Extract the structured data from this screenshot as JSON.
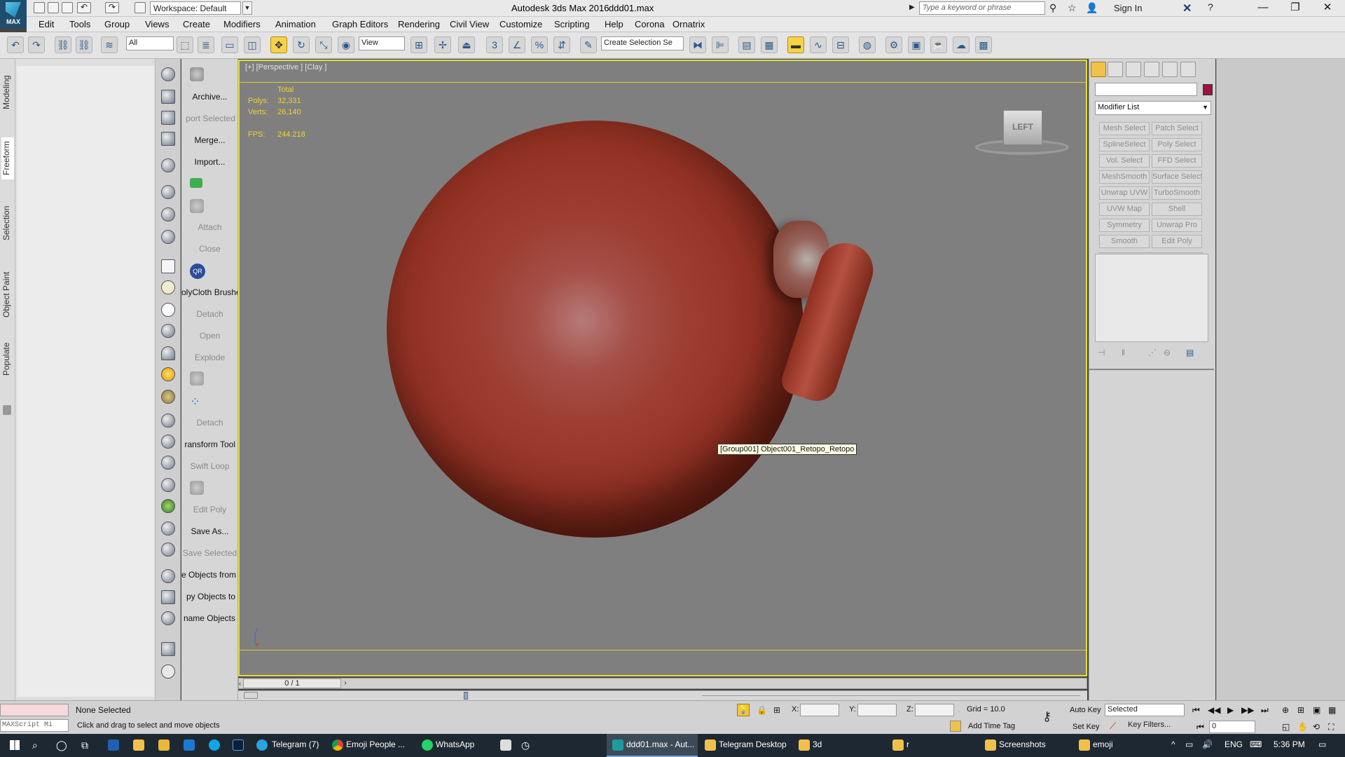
{
  "titlebar": {
    "logo_label": "MAX",
    "workspace": "Workspace: Default",
    "app_title": "Autodesk 3ds Max 2016",
    "doc_name": "ddd01.max",
    "search_placeholder": "Type a keyword or phrase",
    "sign_in": "Sign In"
  },
  "menu": [
    "Edit",
    "Tools",
    "Group",
    "Views",
    "Create",
    "Modifiers",
    "Animation",
    "Graph Editors",
    "Rendering",
    "Civil View",
    "Customize",
    "Scripting",
    "Help",
    "Corona",
    "Ornatrix"
  ],
  "toolbar": {
    "filter": "All",
    "ref_coord": "View",
    "selection_set_placeholder": "Create Selection Se"
  },
  "ribbon_tabs": [
    "Modeling",
    "Freeform",
    "Selection",
    "Object Paint",
    "Populate"
  ],
  "tool_labels": [
    {
      "text": "Archive...",
      "dim": false
    },
    {
      "text": "port Selected",
      "dim": true
    },
    {
      "text": "Merge...",
      "dim": false
    },
    {
      "text": "Import...",
      "dim": false
    },
    {
      "text": "Attach",
      "dim": true
    },
    {
      "text": "Close",
      "dim": true
    },
    {
      "text": "olyCloth Brushe",
      "dim": false
    },
    {
      "text": "Detach",
      "dim": true
    },
    {
      "text": "Open",
      "dim": true
    },
    {
      "text": "Explode",
      "dim": true
    },
    {
      "text": "Detach",
      "dim": true
    },
    {
      "text": "ransform Tool",
      "dim": false
    },
    {
      "text": "Swift Loop",
      "dim": true
    },
    {
      "text": "Edit Poly",
      "dim": true
    },
    {
      "text": "Save As...",
      "dim": false
    },
    {
      "text": "Save Selected",
      "dim": true
    },
    {
      "text": "e Objects from",
      "dim": false
    },
    {
      "text": "py Objects to",
      "dim": false
    },
    {
      "text": "name Objects",
      "dim": false
    }
  ],
  "viewport": {
    "label": "[+] [Perspective ] [Clay ]",
    "stats_header": "Total",
    "polys_label": "Polys:",
    "polys_value": "32,331",
    "verts_label": "Verts:",
    "verts_value": "26,140",
    "fps_label": "FPS:",
    "fps_value": "244.218",
    "viewcube": "LEFT",
    "tooltip": "[Group001] Object001_Retopo_Retopo",
    "axis_z": "z",
    "axis_x": "x"
  },
  "timeslider": {
    "frame": "0 / 1"
  },
  "command_panel": {
    "modifier_list": "Modifier List",
    "buttons": [
      "Mesh Select",
      "Patch Select",
      "SplineSelect",
      "Poly Select",
      "Vol. Select",
      "FFD Select",
      "MeshSmooth",
      "Surface Select",
      "Unwrap UVW",
      "TurboSmooth",
      "UVW Map",
      "Shell",
      "Symmetry",
      "Unwrap Pro",
      "Smooth",
      "Edit Poly"
    ],
    "swatch_color": "#a0123e"
  },
  "status": {
    "maxscript": "MAXScript Mi",
    "selection": "None Selected",
    "hint": "Click and drag to select and move objects",
    "x_label": "X:",
    "y_label": "Y:",
    "z_label": "Z:",
    "grid": "Grid = 10.0",
    "add_time_tag": "Add Time Tag",
    "auto_key": "Auto Key",
    "set_key": "Set Key",
    "selected": "Selected",
    "key_filters": "Key Filters...",
    "frame": "0"
  },
  "taskbar": {
    "items": [
      "Telegram (7)",
      "Emoji People ...",
      "WhatsApp",
      "ddd01.max - Aut...",
      "Telegram Desktop",
      "3d",
      "r",
      "Screenshots",
      "emoji"
    ],
    "lang": "ENG",
    "time": "5:36 PM"
  }
}
